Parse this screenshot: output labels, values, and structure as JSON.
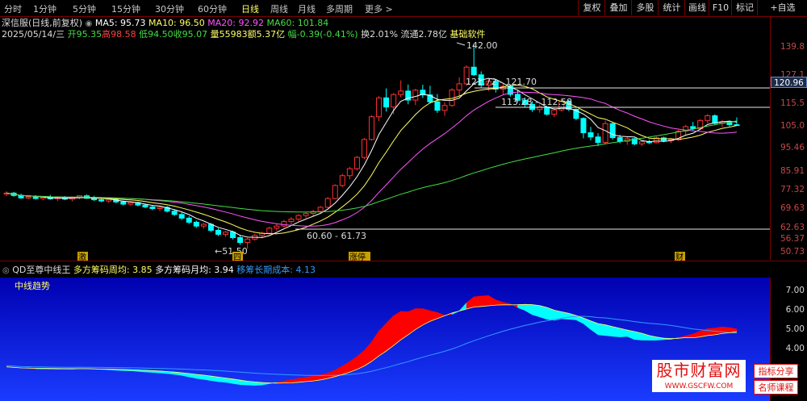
{
  "period_tabs": [
    "分时",
    "1分钟",
    "5分钟",
    "15分钟",
    "30分钟",
    "60分钟",
    "日线",
    "周线",
    "月线",
    "多周期",
    "更多 >"
  ],
  "active_tab": "日线",
  "toolbar": [
    "复权",
    "叠加",
    "多股",
    "统计",
    "画线",
    "F10",
    "标记",
    "+自选"
  ],
  "header": {
    "stock": "深信服(日线,前复权)",
    "ma5": "MA5: 95.73",
    "ma10": "MA10: 96.50",
    "ma20": "MA20: 92.92",
    "ma60": "MA60: 101.84",
    "date": "2025/05/14/三",
    "open": "开95.35",
    "high": "高98.58",
    "low": "低94.50",
    "close": "收95.07",
    "volume": "量55983",
    "amount": "额5.37亿",
    "change": "幅-0.39(-0.41%)",
    "turnover": "换2.01%",
    "float_cap": "流通2.78亿",
    "sector": "基础软件"
  },
  "price_axis": [
    "139.8",
    "127.1",
    "115.5",
    "105.0",
    "95.46",
    "85.91",
    "77.32",
    "69.63",
    "62.63",
    "56.37",
    "50.73"
  ],
  "current_price": "120.96",
  "annotations": {
    "high": "142.00",
    "line1": "121.72 - 121.70",
    "line2": "113.28 - 112.58",
    "line3": "60.60 - 61.73",
    "low": "51.50"
  },
  "event_marks": [
    "激",
    "四",
    "涨停",
    "财"
  ],
  "indicator": {
    "name": "QD至尊中线王",
    "week": "多方筹码周均: 3.85",
    "month": "多方筹码月均: 3.94",
    "long": "移筹长期成本: 4.13",
    "panel_label": "中线趋势",
    "axis": [
      "7.00",
      "6.00",
      "5.00",
      "4.00"
    ]
  },
  "watermark": {
    "title": "股市财富网",
    "url": "WWW.GSCFW.COM",
    "tag1": "指标分享",
    "tag2": "名师课程"
  },
  "colors": {
    "up": "#ff3030",
    "down": "#00ffff",
    "ma5": "#ffffff",
    "ma10": "#ffff66",
    "ma20": "#ff55ff",
    "ma60": "#44dd44",
    "indicator_bg": "#0000cc",
    "fill_up": "#ff0000",
    "fill_down": "#00ffff"
  },
  "chart_data": {
    "type": "candlestick",
    "price_ylim": [
      50.73,
      139.8
    ],
    "candles": [
      [
        67.5,
        68.4,
        66.8,
        67.8
      ],
      [
        67.8,
        68.2,
        66.6,
        67.0
      ],
      [
        67.0,
        67.6,
        65.9,
        66.2
      ],
      [
        66.2,
        67.0,
        65.8,
        66.6
      ],
      [
        66.6,
        67.1,
        65.7,
        66.0
      ],
      [
        66.0,
        66.9,
        65.4,
        66.5
      ],
      [
        66.5,
        67.2,
        65.6,
        65.9
      ],
      [
        65.9,
        66.7,
        65.2,
        66.3
      ],
      [
        66.3,
        66.8,
        65.5,
        65.8
      ],
      [
        65.8,
        66.6,
        65.1,
        66.4
      ],
      [
        66.4,
        67.0,
        65.8,
        66.9
      ],
      [
        66.9,
        67.3,
        65.9,
        66.1
      ],
      [
        66.1,
        66.9,
        65.2,
        65.6
      ],
      [
        65.6,
        66.2,
        64.8,
        65.2
      ],
      [
        65.2,
        66.0,
        64.6,
        65.7
      ],
      [
        65.7,
        66.1,
        64.5,
        64.9
      ],
      [
        64.9,
        65.3,
        63.8,
        64.2
      ],
      [
        64.2,
        65.1,
        63.7,
        64.7
      ],
      [
        64.7,
        65.0,
        63.5,
        63.9
      ],
      [
        63.9,
        64.4,
        62.9,
        63.3
      ],
      [
        63.3,
        63.9,
        62.3,
        62.8
      ],
      [
        62.8,
        63.5,
        62.0,
        63.2
      ],
      [
        63.2,
        63.6,
        61.6,
        62.0
      ],
      [
        62.0,
        62.6,
        60.6,
        61.0
      ],
      [
        61.0,
        61.6,
        59.4,
        59.9
      ],
      [
        59.9,
        60.5,
        58.2,
        58.7
      ],
      [
        58.7,
        59.2,
        57.1,
        57.6
      ],
      [
        57.6,
        58.5,
        56.9,
        58.1
      ],
      [
        58.1,
        58.5,
        55.9,
        56.4
      ],
      [
        56.4,
        57.0,
        54.8,
        55.3
      ],
      [
        55.3,
        56.2,
        54.6,
        55.9
      ],
      [
        55.9,
        56.3,
        53.9,
        54.4
      ],
      [
        54.4,
        55.1,
        52.5,
        53.1
      ],
      [
        53.1,
        54.3,
        51.5,
        54.0
      ],
      [
        54.0,
        55.4,
        53.6,
        55.0
      ],
      [
        55.0,
        56.1,
        54.2,
        55.6
      ],
      [
        55.6,
        57.4,
        55.3,
        57.0
      ],
      [
        57.0,
        58.2,
        56.3,
        57.6
      ],
      [
        57.6,
        59.4,
        57.2,
        58.9
      ],
      [
        58.9,
        60.2,
        58.0,
        59.6
      ],
      [
        59.6,
        61.1,
        59.0,
        60.7
      ],
      [
        60.7,
        61.8,
        60.0,
        61.3
      ],
      [
        61.3,
        62.4,
        60.6,
        61.9
      ],
      [
        61.9,
        63.6,
        61.5,
        63.2
      ],
      [
        63.2,
        66.5,
        62.9,
        66.0
      ],
      [
        66.0,
        70.8,
        65.8,
        70.4
      ],
      [
        70.4,
        74.6,
        69.8,
        73.9
      ],
      [
        73.9,
        77.2,
        72.6,
        76.5
      ],
      [
        76.5,
        81.5,
        75.8,
        80.9
      ],
      [
        80.9,
        89.0,
        80.2,
        88.4
      ],
      [
        88.4,
        99.6,
        87.9,
        98.9
      ],
      [
        98.9,
        109.5,
        96.8,
        108.6
      ],
      [
        108.6,
        113.8,
        101.5,
        103.8
      ],
      [
        103.8,
        111.2,
        100.2,
        110.4
      ],
      [
        110.4,
        118.4,
        108.9,
        112.3
      ],
      [
        112.3,
        116.0,
        105.2,
        107.4
      ],
      [
        107.4,
        113.6,
        104.8,
        112.8
      ],
      [
        112.8,
        115.9,
        108.6,
        110.2
      ],
      [
        110.2,
        115.3,
        105.6,
        106.5
      ],
      [
        106.5,
        110.7,
        100.8,
        102.1
      ],
      [
        102.1,
        106.3,
        99.4,
        104.6
      ],
      [
        104.6,
        113.9,
        103.8,
        112.9
      ],
      [
        112.9,
        120.2,
        109.5,
        116.4
      ],
      [
        116.4,
        127.5,
        115.2,
        126.4
      ],
      [
        126.4,
        142.0,
        121.0,
        121.7
      ],
      [
        121.7,
        123.8,
        114.3,
        115.6
      ],
      [
        115.6,
        119.3,
        112.3,
        117.9
      ],
      [
        117.9,
        118.9,
        111.5,
        113.4
      ],
      [
        113.4,
        116.4,
        110.1,
        115.0
      ],
      [
        115.0,
        115.9,
        109.3,
        110.5
      ],
      [
        110.5,
        112.9,
        106.2,
        107.3
      ],
      [
        107.3,
        108.8,
        103.8,
        105.1
      ],
      [
        105.1,
        106.9,
        101.3,
        102.5
      ],
      [
        102.5,
        105.0,
        100.9,
        103.8
      ],
      [
        103.8,
        104.4,
        99.5,
        100.2
      ],
      [
        100.2,
        103.4,
        98.8,
        102.3
      ],
      [
        102.3,
        108.2,
        101.5,
        106.8
      ],
      [
        106.8,
        107.4,
        101.7,
        102.6
      ],
      [
        102.6,
        103.1,
        97.3,
        98.1
      ],
      [
        98.1,
        98.6,
        88.9,
        91.4
      ],
      [
        91.4,
        94.1,
        88.0,
        89.5
      ],
      [
        89.5,
        91.2,
        85.5,
        87.1
      ],
      [
        87.1,
        97.0,
        86.3,
        95.6
      ],
      [
        95.6,
        96.2,
        88.3,
        89.2
      ],
      [
        89.2,
        90.5,
        86.7,
        87.6
      ],
      [
        87.6,
        89.4,
        86.1,
        88.7
      ],
      [
        88.7,
        89.2,
        85.9,
        86.5
      ],
      [
        86.5,
        88.1,
        85.6,
        87.4
      ],
      [
        87.4,
        88.3,
        86.4,
        87.0
      ],
      [
        87.0,
        89.6,
        86.7,
        89.1
      ],
      [
        89.1,
        89.6,
        87.2,
        87.9
      ],
      [
        87.9,
        88.8,
        86.9,
        88.3
      ],
      [
        88.3,
        92.7,
        87.9,
        92.1
      ],
      [
        92.1,
        95.0,
        90.3,
        94.2
      ],
      [
        94.2,
        96.4,
        92.2,
        93.3
      ],
      [
        93.3,
        97.8,
        92.6,
        97.1
      ],
      [
        97.1,
        100.2,
        95.8,
        99.4
      ],
      [
        99.4,
        100.1,
        95.2,
        95.8
      ],
      [
        95.8,
        97.4,
        94.1,
        96.6
      ],
      [
        96.6,
        97.0,
        94.4,
        95.1
      ],
      [
        95.1,
        98.6,
        94.5,
        95.07
      ]
    ]
  }
}
